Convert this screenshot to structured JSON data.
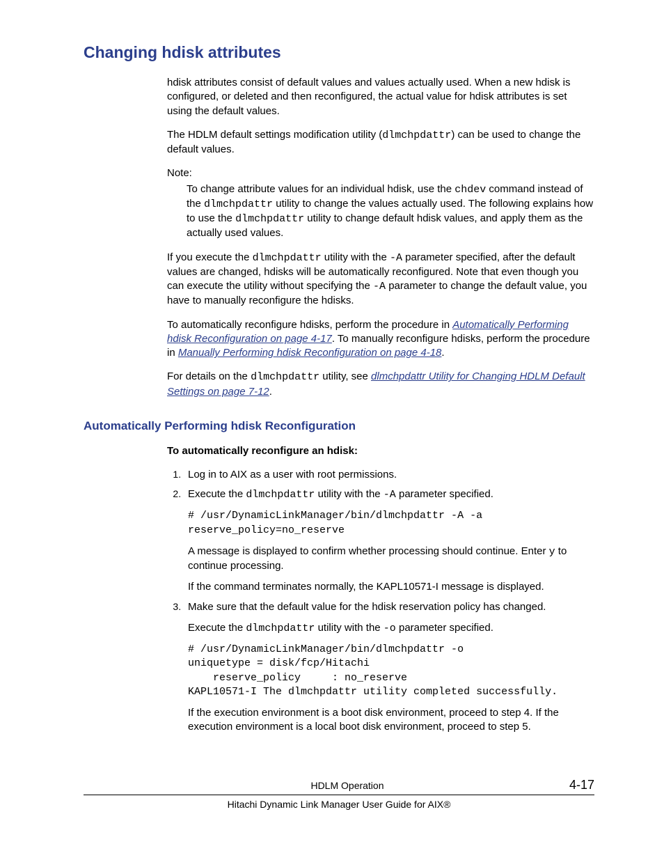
{
  "h1": "Changing hdisk attributes",
  "p1": "hdisk attributes consist of default values and values actually used. When a new hdisk is configured, or deleted and then reconfigured, the actual value for hdisk attributes is set using the default values.",
  "p2a": "The HDLM default settings modification utility (",
  "p2_code": "dlmchpdattr",
  "p2b": ") can be used to change the default values.",
  "note_label": "Note:",
  "note_a": "To change attribute values for an individual hdisk, use the ",
  "note_code1": "chdev",
  "note_b": " command instead of the ",
  "note_code2": "dlmchpdattr",
  "note_c": " utility to change the values actually used. The following explains how to use the ",
  "note_code3": "dlmchpdattr",
  "note_d": " utility to change default hdisk values, and apply them as the actually used values.",
  "p3a": "If you execute the ",
  "p3_code1": "dlmchpdattr",
  "p3b": " utility with the ",
  "p3_code2": "-A",
  "p3c": " parameter specified, after the default values are changed, hdisks will be automatically reconfigured. Note that even though you can execute the utility without specifying the ",
  "p3_code3": "-A",
  "p3d": " parameter to change the default value, you have to manually reconfigure the hdisks.",
  "p4a": "To automatically reconfigure hdisks, perform the procedure in ",
  "p4_link1": "Automatically Performing hdisk Reconfiguration on page 4-17",
  "p4b": ". To manually reconfigure hdisks, perform the procedure in ",
  "p4_link2": "Manually Performing hdisk Reconfiguration on page 4-18",
  "p4c": ".",
  "p5a": "For details on the ",
  "p5_code": "dlmchpdattr",
  "p5b": " utility, see ",
  "p5_link": "dlmchpdattr Utility for Changing HDLM Default Settings on page 7-12",
  "p5c": ".",
  "h2": "Automatically Performing hdisk Reconfiguration",
  "sub_h": "To automatically reconfigure an hdisk:",
  "li1": "Log in to AIX as a user with root permissions.",
  "li2a": "Execute the ",
  "li2_code1": "dlmchpdattr",
  "li2b": " utility with the ",
  "li2_code2": "-A",
  "li2c": " parameter specified.",
  "code1": "# /usr/DynamicLinkManager/bin/dlmchpdattr -A -a reserve_policy=no_reserve",
  "li2_p1a": "A message is displayed to confirm whether processing should continue. Enter ",
  "li2_p1_code": "y",
  "li2_p1b": " to continue processing.",
  "li2_p2": "If the command terminates normally, the KAPL10571-I message is displayed.",
  "li3": "Make sure that the default value for the hdisk reservation policy has changed.",
  "li3_p1a": "Execute the ",
  "li3_p1_code1": "dlmchpdattr",
  "li3_p1b": " utility with the ",
  "li3_p1_code2": "-o",
  "li3_p1c": " parameter specified.",
  "code2": "# /usr/DynamicLinkManager/bin/dlmchpdattr -o\nuniquetype = disk/fcp/Hitachi\n    reserve_policy     : no_reserve\nKAPL10571-I The dlmchpdattr utility completed successfully.",
  "li3_p2": "If the execution environment is a boot disk environment, proceed to step 4. If the execution environment is a local boot disk environment, proceed to step 5.",
  "footer_title": "HDLM Operation",
  "footer_sub": "Hitachi Dynamic Link Manager User Guide for AIX®",
  "page_num": "4-17"
}
